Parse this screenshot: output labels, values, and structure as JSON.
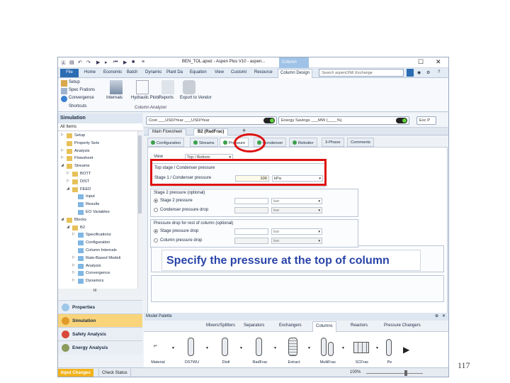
{
  "window": {
    "title": "BEN_TOL.apwz - Aspen Plus V10 - aspen...",
    "context_tab": "Column",
    "controls": {
      "minimize": "–",
      "restore": "☐",
      "close": "✕"
    }
  },
  "ribbon_tabs": [
    "File",
    "Home",
    "Economic",
    "Batch",
    "Dynamic",
    "Plant Da",
    "Equation",
    "View",
    "Customi",
    "Resource",
    "Column Design"
  ],
  "search": {
    "placeholder": "Search aspenONE Exchange"
  },
  "ribbon": {
    "left_items": [
      "Setup",
      "Spec Frations",
      "Convergence",
      "Shortcuts"
    ],
    "tools": [
      "Internals",
      "Hydraulic Plots",
      "Reports",
      "Export to Vendor"
    ],
    "group_label": "Column Analyzer"
  },
  "nav": {
    "header": "Simulation",
    "filter": "All Items",
    "tree": [
      {
        "label": "Setup",
        "indent": 0,
        "arrow": "▷"
      },
      {
        "label": "Property Sets",
        "indent": 0,
        "arrow": ""
      },
      {
        "label": "Analysis",
        "indent": 0,
        "arrow": "▷"
      },
      {
        "label": "Flowsheet",
        "indent": 0,
        "arrow": "▷"
      },
      {
        "label": "Streams",
        "indent": 0,
        "arrow": "◢"
      },
      {
        "label": "BOTT",
        "indent": 1,
        "arrow": "▷"
      },
      {
        "label": "DIST",
        "indent": 1,
        "arrow": "▷"
      },
      {
        "label": "FEED",
        "indent": 1,
        "arrow": "◢"
      },
      {
        "label": "Input",
        "indent": 2,
        "arrow": ""
      },
      {
        "label": "Results",
        "indent": 2,
        "arrow": ""
      },
      {
        "label": "EO Variables",
        "indent": 2,
        "arrow": ""
      },
      {
        "label": "Blocks",
        "indent": 0,
        "arrow": "◢"
      },
      {
        "label": "B2",
        "indent": 1,
        "arrow": "◢"
      },
      {
        "label": "Specifications",
        "indent": 2,
        "arrow": "▷"
      },
      {
        "label": "Configuration",
        "indent": 2,
        "arrow": ""
      },
      {
        "label": "Column Internals",
        "indent": 2,
        "arrow": ""
      },
      {
        "label": "Rate-Based Modeli",
        "indent": 2,
        "arrow": "▷"
      },
      {
        "label": "Analysis",
        "indent": 2,
        "arrow": "▷"
      },
      {
        "label": "Convergence",
        "indent": 2,
        "arrow": "▷"
      },
      {
        "label": "Dynamics",
        "indent": 2,
        "arrow": "▷"
      }
    ],
    "scroll_label": "III",
    "panels": [
      "Properties",
      "Simulation",
      "Safety Analysis",
      "Energy Analysis"
    ]
  },
  "toggles": {
    "cost": "Cost ___USD/Year ___USD/Year",
    "energy": "Energy Savings ___MW (____%)",
    "extra": "Exc P"
  },
  "doc_tabs": [
    "Main Flowsheet",
    "B2 (RadFrac)",
    "+"
  ],
  "form_tabs": [
    "Configuration",
    "Streams",
    "Pressure",
    "Condenser",
    "Reboiler",
    "3-Phase",
    "Comments"
  ],
  "form": {
    "view_label": "View",
    "view_value": "Top / Bottom",
    "sec1_title": "Top stage / Condenser pressure",
    "sec1_row_label": "Stage 1 / Condenser pressure",
    "sec1_value": "100",
    "sec1_unit": "kPa",
    "sec2_title": "Stage 2 pressure (optional)",
    "sec2_opt1": "Stage 2 pressure",
    "sec2_opt1_unit": "bar",
    "sec2_opt2": "Condenser pressure drop",
    "sec2_opt2_unit": "bar",
    "sec3_title": "Pressure drop for rest of column (optional)",
    "sec3_opt1": "Stage pressure drop",
    "sec3_opt1_unit": "bar",
    "sec3_opt2": "Column pressure drop",
    "sec3_opt2_unit": "bar"
  },
  "palette": {
    "title": "Model Palette",
    "tabs": [
      "Mixers/Splitters",
      "Separators",
      "Exchangers",
      "Columns",
      "Reactors",
      "Pressure Changers"
    ],
    "items": [
      "Material",
      "DSTWU",
      "Distl",
      "RadFrac",
      "Extract",
      "MultiFrac",
      "SCFrac",
      "Pe"
    ]
  },
  "status": {
    "required": "Input Changes",
    "check": "Check Status",
    "zoom": "100%"
  },
  "annotation": "Specify the pressure at the top of column",
  "page_number": "117",
  "colors": {
    "accent": "#2b6cb3",
    "highlight_red": "#dd1111",
    "caption_text": "#2a44a8",
    "status_warning": "#f2b21b"
  }
}
